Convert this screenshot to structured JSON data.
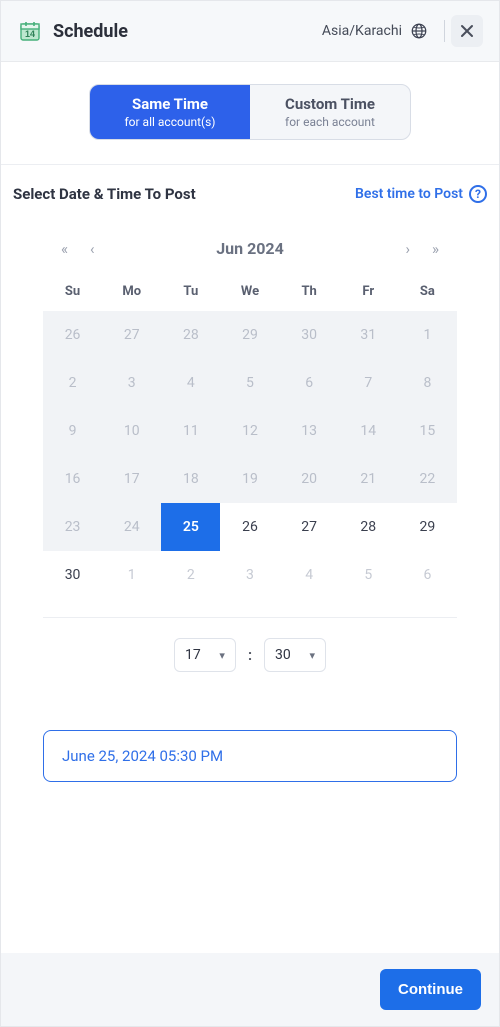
{
  "header": {
    "title": "Schedule",
    "timezone": "Asia/Karachi"
  },
  "tabs": {
    "same": {
      "title": "Same Time",
      "sub": "for all account(s)"
    },
    "custom": {
      "title": "Custom Time",
      "sub": "for each account"
    }
  },
  "section": {
    "title": "Select Date & Time To Post",
    "best_link": "Best time to Post"
  },
  "calendar": {
    "month_label": "Jun  2024",
    "dow": [
      "Su",
      "Mo",
      "Tu",
      "We",
      "Th",
      "Fr",
      "Sa"
    ],
    "weeks": [
      [
        {
          "d": "26",
          "state": "outside"
        },
        {
          "d": "27",
          "state": "outside"
        },
        {
          "d": "28",
          "state": "outside"
        },
        {
          "d": "29",
          "state": "outside"
        },
        {
          "d": "30",
          "state": "outside"
        },
        {
          "d": "31",
          "state": "outside"
        },
        {
          "d": "1",
          "state": "disabled"
        }
      ],
      [
        {
          "d": "2",
          "state": "disabled"
        },
        {
          "d": "3",
          "state": "disabled"
        },
        {
          "d": "4",
          "state": "disabled"
        },
        {
          "d": "5",
          "state": "disabled"
        },
        {
          "d": "6",
          "state": "disabled"
        },
        {
          "d": "7",
          "state": "disabled"
        },
        {
          "d": "8",
          "state": "disabled"
        }
      ],
      [
        {
          "d": "9",
          "state": "disabled"
        },
        {
          "d": "10",
          "state": "disabled"
        },
        {
          "d": "11",
          "state": "disabled"
        },
        {
          "d": "12",
          "state": "disabled"
        },
        {
          "d": "13",
          "state": "disabled"
        },
        {
          "d": "14",
          "state": "disabled"
        },
        {
          "d": "15",
          "state": "disabled"
        }
      ],
      [
        {
          "d": "16",
          "state": "disabled"
        },
        {
          "d": "17",
          "state": "disabled"
        },
        {
          "d": "18",
          "state": "disabled"
        },
        {
          "d": "19",
          "state": "disabled"
        },
        {
          "d": "20",
          "state": "disabled"
        },
        {
          "d": "21",
          "state": "disabled"
        },
        {
          "d": "22",
          "state": "disabled"
        }
      ],
      [
        {
          "d": "23",
          "state": "disabled"
        },
        {
          "d": "24",
          "state": "disabled"
        },
        {
          "d": "25",
          "state": "selected"
        },
        {
          "d": "26",
          "state": "inmonth"
        },
        {
          "d": "27",
          "state": "inmonth"
        },
        {
          "d": "28",
          "state": "inmonth"
        },
        {
          "d": "29",
          "state": "inmonth"
        }
      ],
      [
        {
          "d": "30",
          "state": "inmonth"
        },
        {
          "d": "1",
          "state": "next-outside"
        },
        {
          "d": "2",
          "state": "next-outside"
        },
        {
          "d": "3",
          "state": "next-outside"
        },
        {
          "d": "4",
          "state": "next-outside"
        },
        {
          "d": "5",
          "state": "next-outside"
        },
        {
          "d": "6",
          "state": "next-outside"
        }
      ]
    ]
  },
  "time": {
    "hour": "17",
    "minute": "30",
    "colon": ":"
  },
  "summary": "June 25, 2024 05:30 PM",
  "footer": {
    "continue_label": "Continue"
  }
}
